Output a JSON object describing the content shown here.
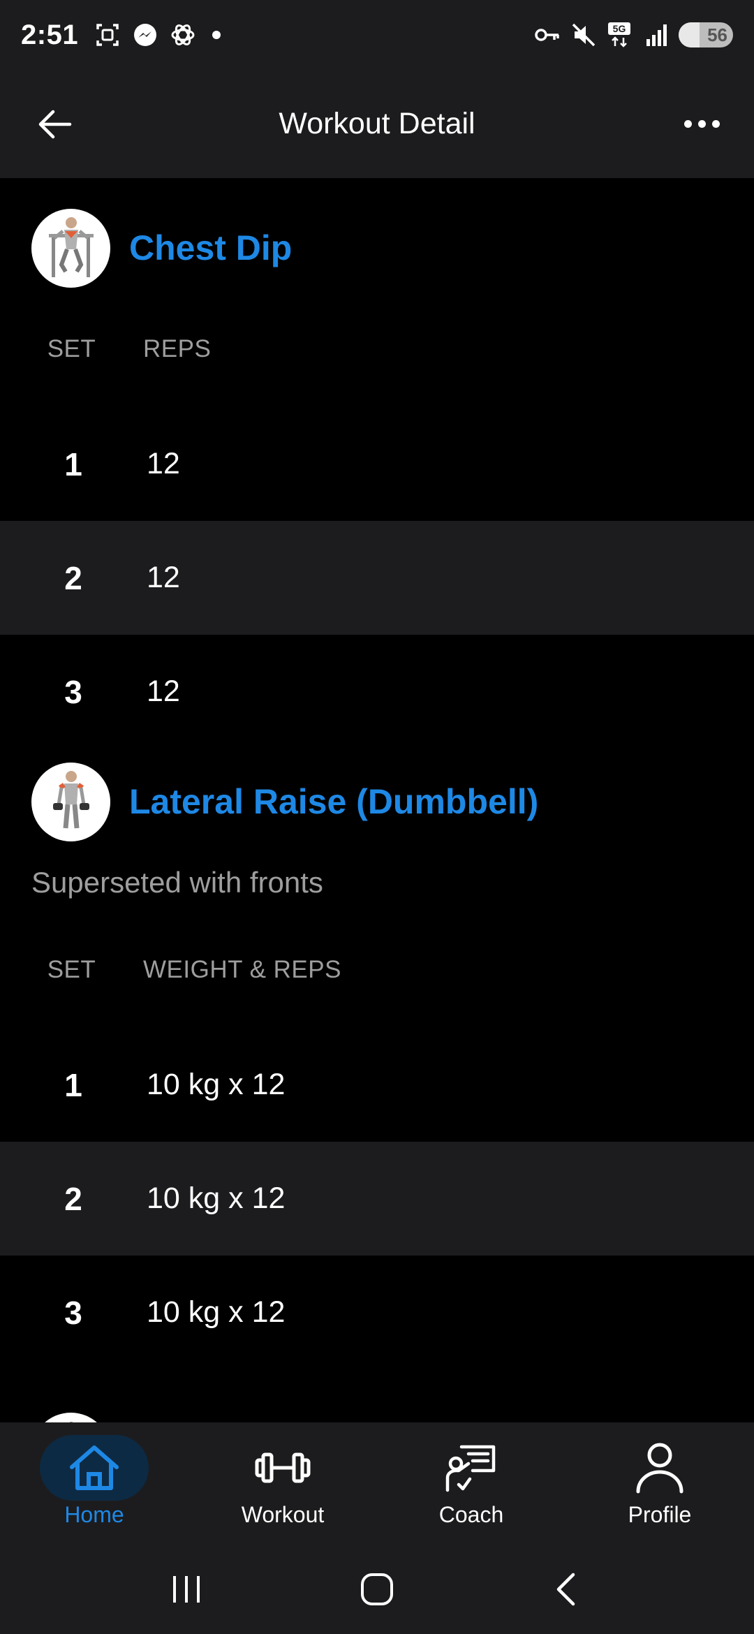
{
  "status_bar": {
    "time": "2:51",
    "battery_level": "56",
    "network": "5G",
    "icons": [
      "screenshot-icon",
      "messenger-icon",
      "chatgpt-icon",
      "notification-dot",
      "vpn-key-icon",
      "mute-icon",
      "5g-icon",
      "signal-icon",
      "battery-icon"
    ]
  },
  "header": {
    "title": "Workout Detail",
    "back_icon": "arrow-left-icon",
    "more_icon": "more-horizontal-icon"
  },
  "exercises": [
    {
      "name": "Chest Dip",
      "note": "",
      "col_set": "SET",
      "col_value": "REPS",
      "sets": [
        {
          "num": "1",
          "value": "12"
        },
        {
          "num": "2",
          "value": "12"
        },
        {
          "num": "3",
          "value": "12"
        }
      ]
    },
    {
      "name": "Lateral Raise (Dumbbell)",
      "note": "Superseted with fronts",
      "col_set": "SET",
      "col_value": "WEIGHT & REPS",
      "sets": [
        {
          "num": "1",
          "value": "10 kg x 12"
        },
        {
          "num": "2",
          "value": "10 kg x 12"
        },
        {
          "num": "3",
          "value": "10 kg x 12"
        }
      ]
    }
  ],
  "bottom_nav": {
    "items": [
      {
        "label": "Home",
        "icon": "home-icon",
        "active": true
      },
      {
        "label": "Workout",
        "icon": "dumbbell-icon",
        "active": false
      },
      {
        "label": "Coach",
        "icon": "coach-icon",
        "active": false
      },
      {
        "label": "Profile",
        "icon": "profile-icon",
        "active": false
      }
    ]
  },
  "system_nav": {
    "icons": [
      "recent-apps-icon",
      "home-button-icon",
      "back-button-icon"
    ]
  },
  "colors": {
    "accent": "#1e88e5",
    "background": "#000000",
    "surface": "#1c1c1e",
    "muted_text": "#9e9e9e"
  }
}
